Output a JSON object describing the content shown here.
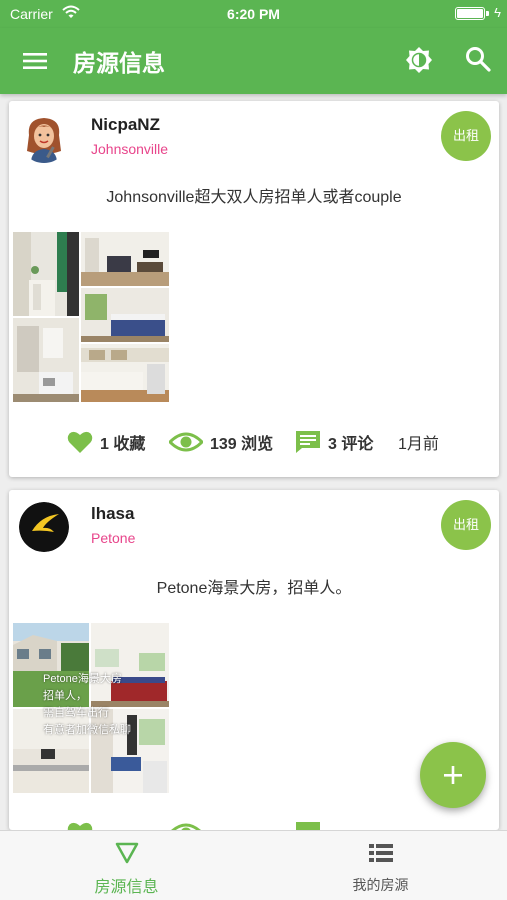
{
  "status_bar": {
    "carrier": "Carrier",
    "time": "6:20 PM"
  },
  "app_bar": {
    "title": "房源信息"
  },
  "listings": [
    {
      "user": "NicpaNZ",
      "location": "Johnsonville",
      "badge": "出租",
      "title": "Johnsonville超大双人房招单人或者couple",
      "favorites": "1 收藏",
      "views": "139 浏览",
      "comments": "3 评论",
      "time_ago": "1月前"
    },
    {
      "user": "lhasa",
      "location": "Petone",
      "badge": "出租",
      "title": "Petone海景大房，招单人。",
      "photo_caption": [
        "Petone海景大房",
        "招单人，",
        "需自驾车出行",
        "有意者加微信私聊"
      ]
    }
  ],
  "fab": {
    "icon": "plus-icon"
  },
  "tab_bar": {
    "tabs": [
      {
        "label": "房源信息",
        "icon": "triangle-down-icon",
        "active": true
      },
      {
        "label": "我的房源",
        "icon": "list-icon",
        "active": false
      }
    ]
  },
  "colors": {
    "primary": "#5bb552",
    "accent": "#8bc34a",
    "location": "#e8458b"
  }
}
